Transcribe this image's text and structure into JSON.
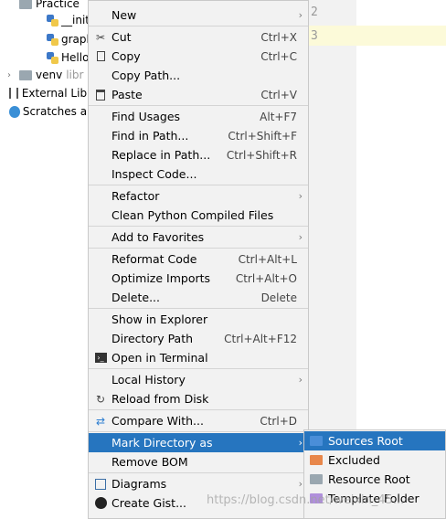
{
  "tree": {
    "rows": [
      {
        "label": "Practice",
        "dim": ""
      },
      {
        "label": "__init_",
        "dim": ""
      },
      {
        "label": "graph",
        "dim": ""
      },
      {
        "label": "Hello",
        "dim": ""
      },
      {
        "label": "venv",
        "dim": "libr"
      },
      {
        "label": "External Libr",
        "dim": ""
      },
      {
        "label": "Scratches ar",
        "dim": ""
      }
    ]
  },
  "editor": {
    "line_numbers": [
      "2",
      "3"
    ]
  },
  "menu": {
    "items": [
      {
        "label": "New",
        "shortcut": "",
        "submenu": true,
        "icon": ""
      },
      {
        "label": "Cut",
        "shortcut": "Ctrl+X",
        "submenu": false,
        "icon": "scissors-icon"
      },
      {
        "label": "Copy",
        "shortcut": "Ctrl+C",
        "submenu": false,
        "icon": "copy-icon"
      },
      {
        "label": "Copy Path...",
        "shortcut": "",
        "submenu": false,
        "icon": ""
      },
      {
        "label": "Paste",
        "shortcut": "Ctrl+V",
        "submenu": false,
        "icon": "paste-icon"
      },
      {
        "label": "Find Usages",
        "shortcut": "Alt+F7",
        "submenu": false,
        "icon": ""
      },
      {
        "label": "Find in Path...",
        "shortcut": "Ctrl+Shift+F",
        "submenu": false,
        "icon": ""
      },
      {
        "label": "Replace in Path...",
        "shortcut": "Ctrl+Shift+R",
        "submenu": false,
        "icon": ""
      },
      {
        "label": "Inspect Code...",
        "shortcut": "",
        "submenu": false,
        "icon": ""
      },
      {
        "label": "Refactor",
        "shortcut": "",
        "submenu": true,
        "icon": ""
      },
      {
        "label": "Clean Python Compiled Files",
        "shortcut": "",
        "submenu": false,
        "icon": ""
      },
      {
        "label": "Add to Favorites",
        "shortcut": "",
        "submenu": true,
        "icon": ""
      },
      {
        "label": "Reformat Code",
        "shortcut": "Ctrl+Alt+L",
        "submenu": false,
        "icon": ""
      },
      {
        "label": "Optimize Imports",
        "shortcut": "Ctrl+Alt+O",
        "submenu": false,
        "icon": ""
      },
      {
        "label": "Delete...",
        "shortcut": "Delete",
        "submenu": false,
        "icon": ""
      },
      {
        "label": "Show in Explorer",
        "shortcut": "",
        "submenu": false,
        "icon": ""
      },
      {
        "label": "Directory Path",
        "shortcut": "Ctrl+Alt+F12",
        "submenu": false,
        "icon": ""
      },
      {
        "label": "Open in Terminal",
        "shortcut": "",
        "submenu": false,
        "icon": "terminal-icon"
      },
      {
        "label": "Local History",
        "shortcut": "",
        "submenu": true,
        "icon": ""
      },
      {
        "label": "Reload from Disk",
        "shortcut": "",
        "submenu": false,
        "icon": "reload-icon"
      },
      {
        "label": "Compare With...",
        "shortcut": "Ctrl+D",
        "submenu": false,
        "icon": "compare-icon"
      },
      {
        "label": "Mark Directory as",
        "shortcut": "",
        "submenu": true,
        "icon": "",
        "active": true
      },
      {
        "label": "Remove BOM",
        "shortcut": "",
        "submenu": false,
        "icon": ""
      },
      {
        "label": "Diagrams",
        "shortcut": "",
        "submenu": true,
        "icon": "diagrams-icon"
      },
      {
        "label": "Create Gist...",
        "shortcut": "",
        "submenu": false,
        "icon": "github-icon"
      }
    ]
  },
  "submenu": {
    "items": [
      {
        "label": "Sources Root",
        "color": "#4a8ed8",
        "active": true
      },
      {
        "label": "Excluded",
        "color": "#e8874b",
        "active": false
      },
      {
        "label": "Resource Root",
        "color": "#9aa7b0",
        "active": false
      },
      {
        "label": "Template Folder",
        "color": "#b08fdc",
        "active": false
      }
    ]
  },
  "watermark": "https://blog.csdn.net/weixin_45..."
}
